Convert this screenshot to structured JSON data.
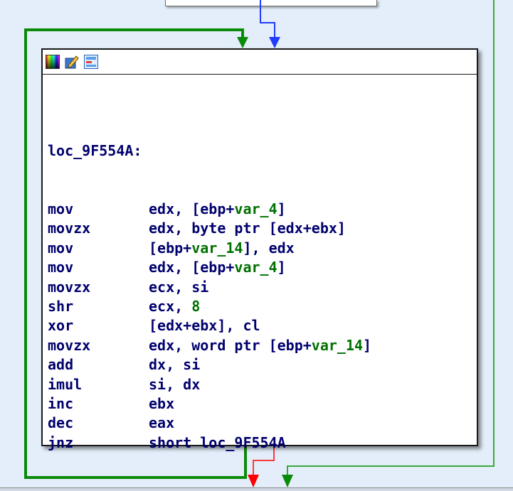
{
  "graph": {
    "colors": {
      "background": "#e3eefa",
      "text": "#00006e",
      "symbol": "#007000",
      "edge_true": "#008000",
      "edge_false": "#ff0000",
      "edge_jump": "#0000ff",
      "edge_loop": "#008000"
    },
    "node": {
      "toolbar_icons": [
        "set-node-color-icon",
        "rename-icon",
        "group-nodes-icon"
      ],
      "label": "loc_9F554A:",
      "instructions": [
        {
          "mnemonic": "mov",
          "operands": [
            {
              "t": "edx, [ebp+"
            },
            {
              "v": "var_4"
            },
            {
              "t": "]"
            }
          ]
        },
        {
          "mnemonic": "movzx",
          "operands": [
            {
              "t": "edx, byte ptr [edx+ebx]"
            }
          ]
        },
        {
          "mnemonic": "mov",
          "operands": [
            {
              "t": "[ebp+"
            },
            {
              "v": "var_14"
            },
            {
              "t": "], edx"
            }
          ]
        },
        {
          "mnemonic": "mov",
          "operands": [
            {
              "t": "edx, [ebp+"
            },
            {
              "v": "var_4"
            },
            {
              "t": "]"
            }
          ]
        },
        {
          "mnemonic": "movzx",
          "operands": [
            {
              "t": "ecx, si"
            }
          ]
        },
        {
          "mnemonic": "shr",
          "operands": [
            {
              "t": "ecx, "
            },
            {
              "n": "8"
            }
          ]
        },
        {
          "mnemonic": "xor",
          "operands": [
            {
              "t": "[edx+ebx], cl"
            }
          ]
        },
        {
          "mnemonic": "movzx",
          "operands": [
            {
              "t": "edx, word ptr [ebp+"
            },
            {
              "v": "var_14"
            },
            {
              "t": "]"
            }
          ]
        },
        {
          "mnemonic": "add",
          "operands": [
            {
              "t": "dx, si"
            }
          ]
        },
        {
          "mnemonic": "imul",
          "operands": [
            {
              "t": "si, dx"
            }
          ]
        },
        {
          "mnemonic": "inc",
          "operands": [
            {
              "t": "ebx"
            }
          ]
        },
        {
          "mnemonic": "dec",
          "operands": [
            {
              "t": "eax"
            }
          ]
        },
        {
          "mnemonic": "jnz",
          "operands": [
            {
              "t": "short loc_9F554A"
            }
          ]
        }
      ]
    }
  }
}
